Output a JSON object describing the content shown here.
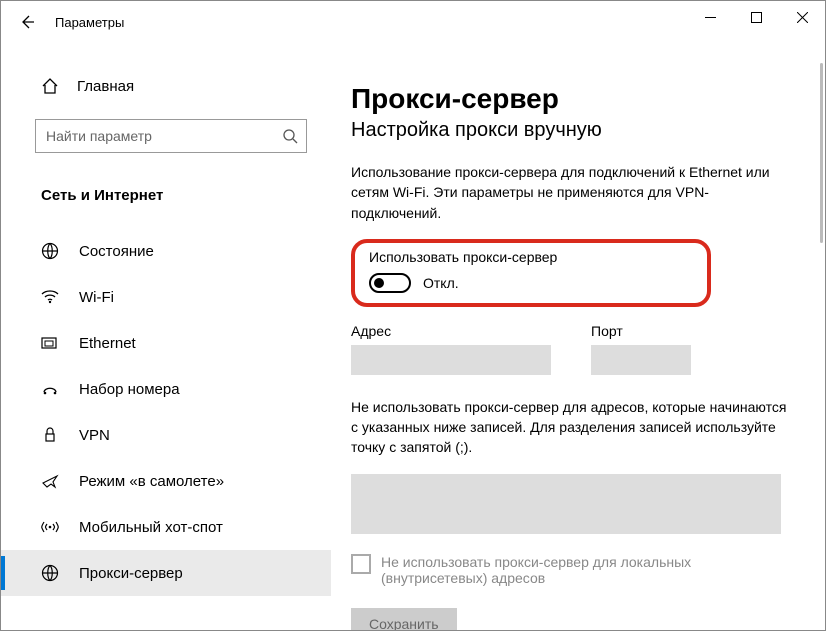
{
  "titlebar": {
    "title": "Параметры"
  },
  "sidebar": {
    "home": "Главная",
    "search_placeholder": "Найти параметр",
    "category": "Сеть и Интернет",
    "items": [
      {
        "label": "Состояние"
      },
      {
        "label": "Wi-Fi"
      },
      {
        "label": "Ethernet"
      },
      {
        "label": "Набор номера"
      },
      {
        "label": "VPN"
      },
      {
        "label": "Режим «в самолете»"
      },
      {
        "label": "Мобильный хот-спот"
      },
      {
        "label": "Прокси-сервер"
      }
    ]
  },
  "main": {
    "heading": "Прокси-сервер",
    "subheading": "Настройка прокси вручную",
    "description": "Использование прокси-сервера для подключений к Ethernet или сетям Wi-Fi. Эти параметры не применяются для VPN-подключений.",
    "use_proxy_label": "Использовать прокси-сервер",
    "toggle_state": "Откл.",
    "addr_label": "Адрес",
    "port_label": "Порт",
    "exceptions_text": "Не использовать прокси-сервер для адресов, которые начинаются с указанных ниже записей. Для разделения записей используйте точку с запятой (;).",
    "local_checkbox": "Не использовать прокси-сервер для локальных (внутрисетевых) адресов",
    "save": "Сохранить"
  }
}
